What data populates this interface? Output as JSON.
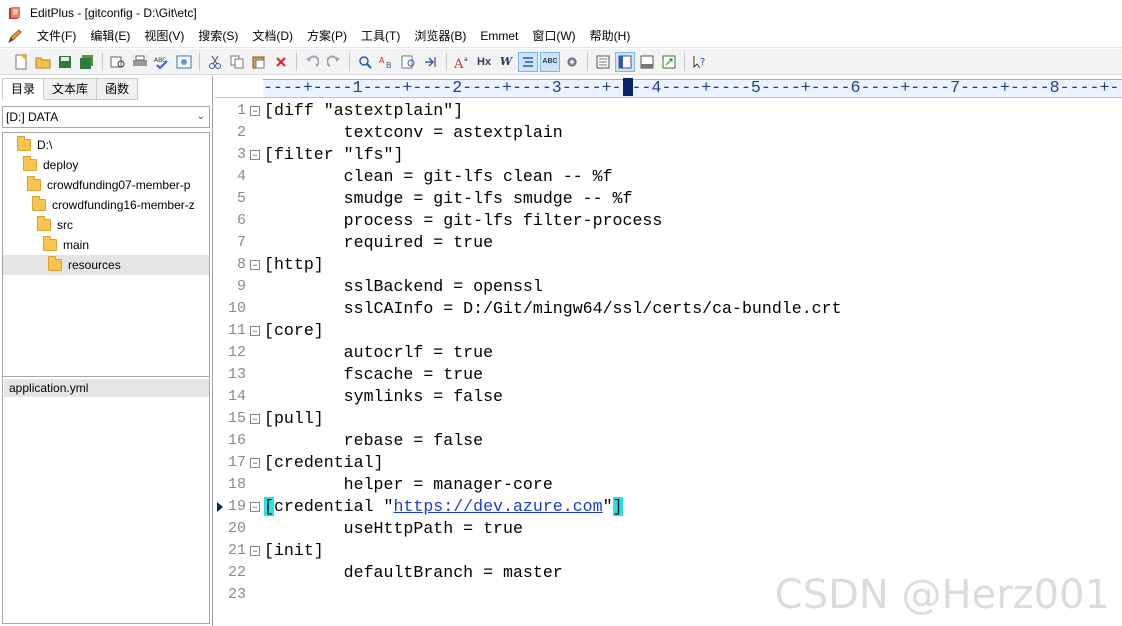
{
  "window": {
    "title": "EditPlus - [gitconfig - D:\\Git\\etc]"
  },
  "menu": [
    "文件(F)",
    "编辑(E)",
    "视图(V)",
    "搜索(S)",
    "文档(D)",
    "方案(P)",
    "工具(T)",
    "浏览器(B)",
    "Emmet",
    "窗口(W)",
    "帮助(H)"
  ],
  "toolbar": {
    "buttons": [
      "new-file-icon",
      "open-folder-icon",
      "save-icon",
      "save-all-icon",
      "print-preview-icon",
      "print-icon",
      "spell-check-icon",
      "html-preview-icon",
      "cut-icon",
      "copy-icon",
      "paste-icon",
      "delete-icon",
      "undo-icon",
      "redo-icon",
      "find-icon",
      "replace-icon",
      "find-in-files-icon",
      "goto-line-icon",
      "font-size-icon",
      "hx-heading-icon",
      "word-wrap-icon",
      "line-number-icon",
      "ruler-icon",
      "settings-icon",
      "column-mode-icon",
      "directory-window-icon",
      "output-window-icon",
      "fullscreen-icon",
      "help-icon"
    ],
    "labels": {
      "hx": "Hx",
      "ww": "W",
      "abc": "ABC"
    }
  },
  "sidebar": {
    "tabs": [
      "目录",
      "文本库",
      "函数"
    ],
    "drive": "[D:] DATA",
    "tree": [
      {
        "label": "D:\\",
        "indent": 0
      },
      {
        "label": "deploy",
        "indent": 1
      },
      {
        "label": "crowdfunding07-member-p",
        "indent": 2
      },
      {
        "label": "crowdfunding16-member-z",
        "indent": 3
      },
      {
        "label": "src",
        "indent": 4
      },
      {
        "label": "main",
        "indent": 5
      },
      {
        "label": "resources",
        "indent": 6,
        "selected": true
      }
    ],
    "files": [
      "application.yml"
    ]
  },
  "editor": {
    "ruler": "----+----1----+----2----+----3----+- --4----+----5----+----6----+----7----+----8----+-",
    "lines": [
      {
        "n": "1",
        "fold": true,
        "text": "[diff \"astextplain\"]"
      },
      {
        "n": "2",
        "fold": false,
        "text": "        textconv = astextplain"
      },
      {
        "n": "3",
        "fold": true,
        "text": "[filter \"lfs\"]"
      },
      {
        "n": "4",
        "fold": false,
        "text": "        clean = git-lfs clean -- %f"
      },
      {
        "n": "5",
        "fold": false,
        "text": "        smudge = git-lfs smudge -- %f"
      },
      {
        "n": "6",
        "fold": false,
        "text": "        process = git-lfs filter-process"
      },
      {
        "n": "7",
        "fold": false,
        "text": "        required = true"
      },
      {
        "n": "8",
        "fold": true,
        "text": "[http]"
      },
      {
        "n": "9",
        "fold": false,
        "text": "        sslBackend = openssl"
      },
      {
        "n": "10",
        "fold": false,
        "text": "        sslCAInfo = D:/Git/mingw64/ssl/certs/ca-bundle.crt"
      },
      {
        "n": "11",
        "fold": true,
        "text": "[core]"
      },
      {
        "n": "12",
        "fold": false,
        "text": "        autocrlf = true"
      },
      {
        "n": "13",
        "fold": false,
        "text": "        fscache = true"
      },
      {
        "n": "14",
        "fold": false,
        "text": "        symlinks = false"
      },
      {
        "n": "15",
        "fold": true,
        "text": "[pull]"
      },
      {
        "n": "16",
        "fold": false,
        "text": "        rebase = false"
      },
      {
        "n": "17",
        "fold": true,
        "text": "[credential]"
      },
      {
        "n": "18",
        "fold": false,
        "text": "        helper = manager-core"
      },
      {
        "n": "19",
        "fold": true,
        "current": true,
        "text_parts": [
          "[",
          "credential \"",
          "https://dev.azure.com",
          "\"",
          "]"
        ]
      },
      {
        "n": "20",
        "fold": false,
        "text": "        useHttpPath = true"
      },
      {
        "n": "21",
        "fold": true,
        "text": "[init]"
      },
      {
        "n": "22",
        "fold": false,
        "text": "        defaultBranch = master"
      },
      {
        "n": "23",
        "fold": false,
        "text": ""
      }
    ]
  },
  "watermark": "CSDN @Herz001"
}
